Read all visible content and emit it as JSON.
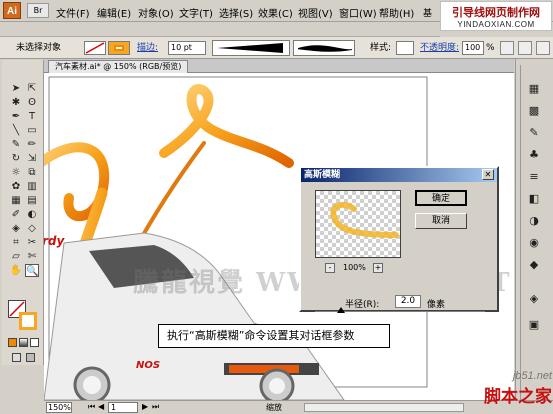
{
  "app": {
    "logo": "Ai",
    "doc_icon": "Br"
  },
  "menu": [
    "文件(F)",
    "编辑(E)",
    "对象(O)",
    "文字(T)",
    "选择(S)",
    "效果(C)",
    "视图(V)",
    "窗口(W)",
    "帮助(H)"
  ],
  "window_min": "基",
  "site_badge": {
    "title": "引导线网页制作网",
    "url": "YINDAOXIAN.COM"
  },
  "control_bar": {
    "selection": "未选择对象",
    "stroke_label": "描边:",
    "stroke_value": "10 pt",
    "style_label": "样式:",
    "opacity_label": "不透明度:",
    "opacity_value": "100",
    "opacity_unit": "%"
  },
  "tab": {
    "title": "汽车素材.ai* @ 150% (RGB/预览)"
  },
  "status": {
    "zoom": "150%",
    "page": "1",
    "mode": "缩放"
  },
  "dialog": {
    "title": "高斯模糊",
    "ok_label": "确定",
    "cancel_label": "取消",
    "zoom_minus": "-",
    "zoom_value": "100%",
    "zoom_plus": "+",
    "radius_label": "半径(R):",
    "radius_value": "2.0",
    "radius_unit": "像素"
  },
  "caption": "执行“高斯模糊”命令设置其对话框参数",
  "watermark": "騰龍視覺 WWW.TLVI.NET",
  "car_badge": "NOS",
  "footer_badge": {
    "site": "jb51.net",
    "name": "脚本之家"
  },
  "colors": {
    "orange": "#f08a00",
    "title_blue": "#0a246a",
    "red": "#c81010"
  }
}
